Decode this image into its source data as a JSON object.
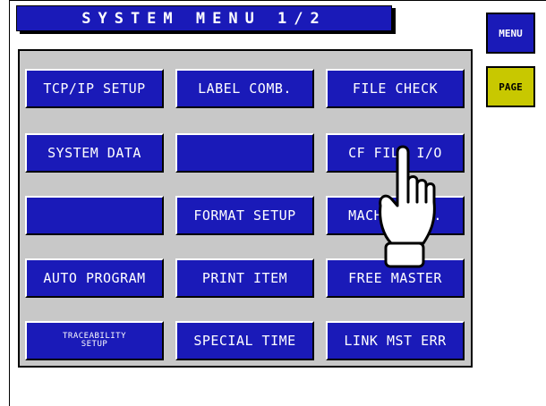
{
  "header": {
    "title": "SYSTEM MENU 1/2"
  },
  "side": {
    "menu_label": "MENU",
    "page_label": "PAGE"
  },
  "grid": {
    "row1": [
      "TCP/IP SETUP",
      "LABEL COMB.",
      "FILE CHECK"
    ],
    "row2": [
      "SYSTEM DATA",
      "",
      "CF FILE I/O"
    ],
    "row3": [
      "",
      "FORMAT SETUP",
      "MACHINE No."
    ],
    "row4": [
      "AUTO PROGRAM",
      "PRINT ITEM",
      "FREE MASTER"
    ],
    "row5": [
      "TRACEABILITY\nSETUP",
      "SPECIAL TIME",
      "LINK MST ERR"
    ]
  },
  "colors": {
    "button_blue": "#1a1ab8",
    "panel_gray": "#c8c8c8",
    "page_yellow": "#c8c800"
  },
  "icons": {
    "pointer": "hand-pointer-icon"
  }
}
